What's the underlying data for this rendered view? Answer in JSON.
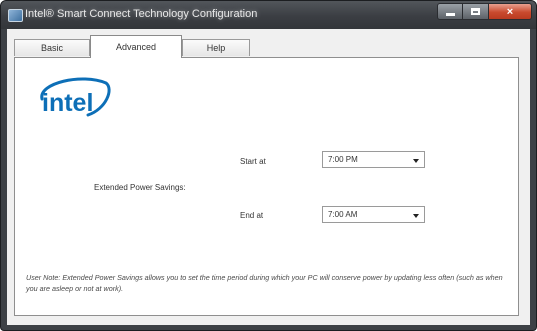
{
  "window": {
    "title": "Intel® Smart Connect Technology Configuration",
    "close_glyph": "×"
  },
  "tabs": [
    {
      "label": "Basic",
      "active": false
    },
    {
      "label": "Advanced",
      "active": true
    },
    {
      "label": "Help",
      "active": false
    }
  ],
  "logo": {
    "text": "intel",
    "color": "#0d6fb7",
    "icon": "intel-logo-icon"
  },
  "advanced": {
    "extended_power_savings_label": "Extended Power Savings:",
    "start_label": "Start at",
    "start_value": "7:00 PM",
    "end_label": "End at",
    "end_value": "7:00 AM",
    "note": "User Note: Extended Power Savings allows you to set the time period during which your PC will conserve power by updating less often (such as when you are asleep or not at work)."
  },
  "icons": {
    "app": "app-icon",
    "minimize": "minimize-icon",
    "maximize": "maximize-icon",
    "close": "close-icon",
    "dropdown": "chevron-down-icon"
  }
}
